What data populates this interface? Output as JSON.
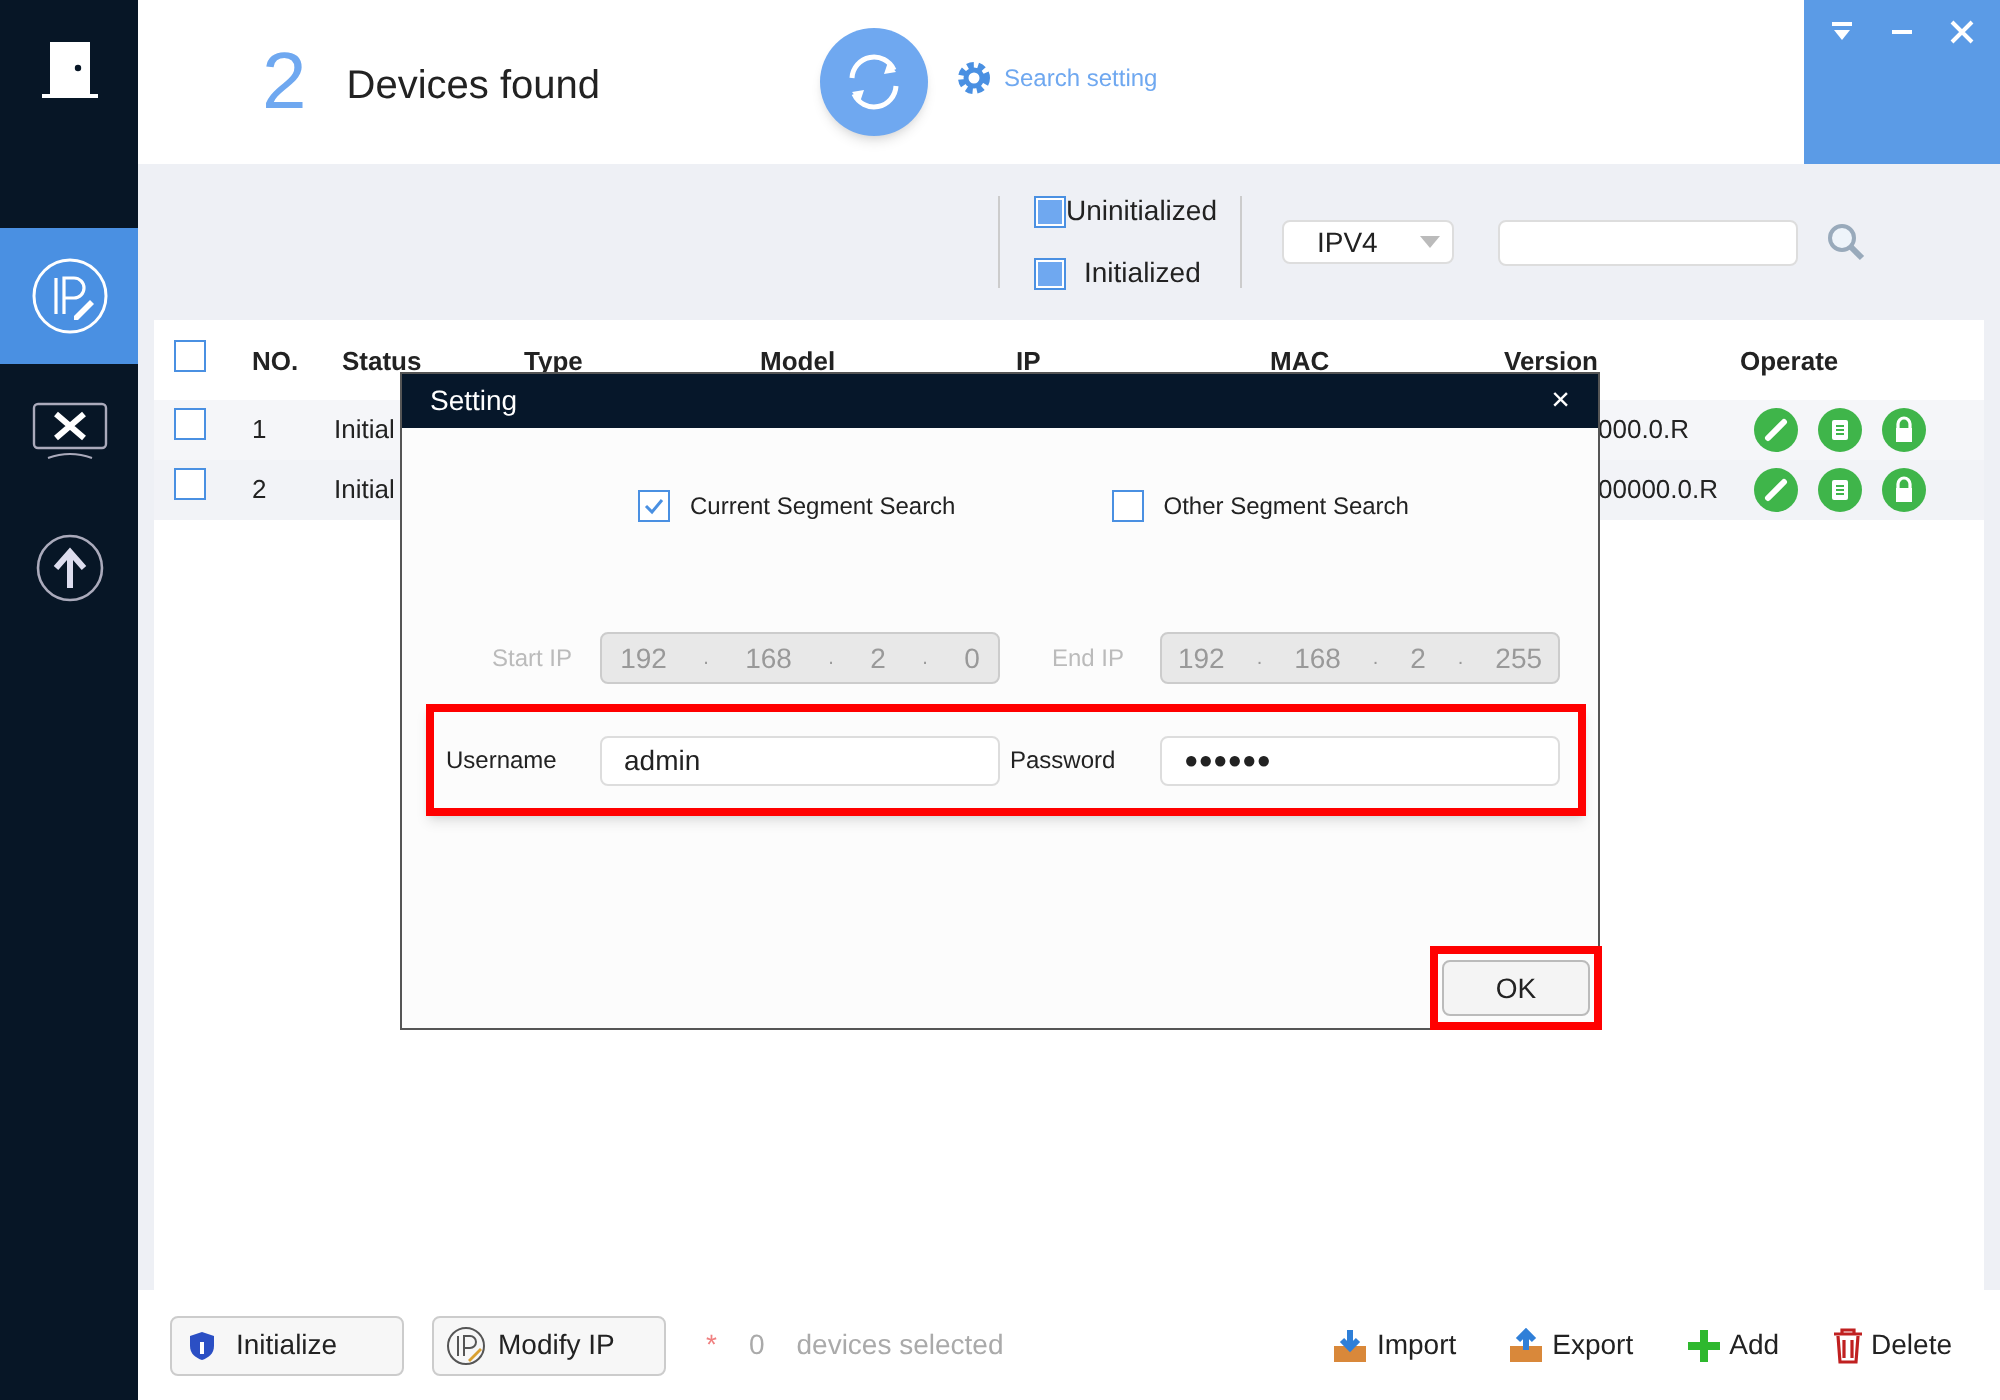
{
  "header": {
    "count": "2",
    "title": "Devices found",
    "search_setting": "Search setting"
  },
  "sidebar": {
    "items": [
      {
        "kind": "ip",
        "selected": true
      },
      {
        "kind": "tools",
        "selected": false
      },
      {
        "kind": "upgrade",
        "selected": false
      }
    ]
  },
  "filters": {
    "uninitialized": {
      "label": "Uninitialized",
      "checked": true
    },
    "initialized": {
      "label": "Initialized",
      "checked": true
    },
    "protocol": "IPV4"
  },
  "table": {
    "select_all": false,
    "columns": [
      "NO.",
      "Status",
      "Type",
      "Model",
      "IP",
      "MAC",
      "Version",
      "Operate"
    ],
    "rows": [
      {
        "selected": false,
        "no": "1",
        "status": "Initial",
        "version": "000.0.R"
      },
      {
        "selected": false,
        "no": "2",
        "status": "Initial",
        "version": "00000.0.R"
      }
    ]
  },
  "dialog": {
    "title": "Setting",
    "close": "×",
    "modes": [
      {
        "label": "Current Segment Search",
        "checked": true
      },
      {
        "label": "Other Segment Search",
        "checked": false
      }
    ],
    "start_ip": {
      "label": "Start IP",
      "octets": [
        "192",
        "168",
        "2",
        "0"
      ],
      "separators": [
        ".",
        ".",
        "."
      ]
    },
    "end_ip": {
      "label": "End IP",
      "octets": [
        "192",
        "168",
        "2",
        "255"
      ],
      "separators": [
        ".",
        ".",
        "."
      ]
    },
    "username": {
      "label": "Username",
      "value": "admin"
    },
    "password": {
      "label": "Password",
      "value": "●●●●●●"
    },
    "ok": "OK"
  },
  "footer": {
    "initialize": "Initialize",
    "modify_ip": "Modify IP",
    "star": "*",
    "selected_count": "0",
    "selected_text": "devices selected",
    "actions": [
      {
        "kind": "import",
        "label": "Import"
      },
      {
        "kind": "export",
        "label": "Export"
      },
      {
        "kind": "add",
        "label": "Add"
      },
      {
        "kind": "delete",
        "label": "Delete"
      }
    ]
  }
}
